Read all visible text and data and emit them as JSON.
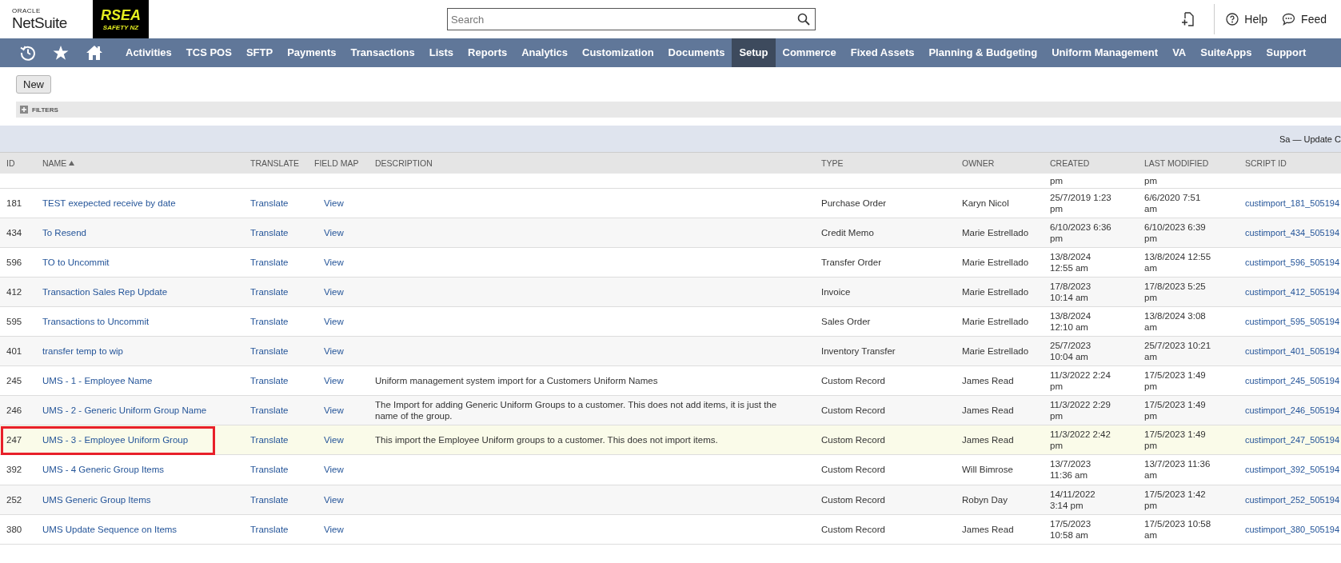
{
  "header": {
    "logo": {
      "top": "ORACLE",
      "bottom": "NetSuite"
    },
    "brand": {
      "name": "RSEA",
      "tagline": "SAFETY NZ"
    },
    "search": {
      "placeholder": "Search"
    },
    "links": [
      {
        "kind": "help",
        "label": "Help"
      },
      {
        "kind": "feedback",
        "label": "Feed"
      }
    ]
  },
  "nav": {
    "items": [
      {
        "label": "Activities",
        "selected": false
      },
      {
        "label": "TCS POS",
        "selected": false
      },
      {
        "label": "SFTP",
        "selected": false
      },
      {
        "label": "Payments",
        "selected": false
      },
      {
        "label": "Transactions",
        "selected": false
      },
      {
        "label": "Lists",
        "selected": false
      },
      {
        "label": "Reports",
        "selected": false
      },
      {
        "label": "Analytics",
        "selected": false
      },
      {
        "label": "Customization",
        "selected": false
      },
      {
        "label": "Documents",
        "selected": false
      },
      {
        "label": "Setup",
        "selected": true
      },
      {
        "label": "Commerce",
        "selected": false
      },
      {
        "label": "Fixed Assets",
        "selected": false
      },
      {
        "label": "Planning & Budgeting",
        "selected": false
      },
      {
        "label": "Uniform Management",
        "selected": false
      },
      {
        "label": "VA",
        "selected": false
      },
      {
        "label": "SuiteApps",
        "selected": false
      },
      {
        "label": "Support",
        "selected": false
      }
    ]
  },
  "toolbar": {
    "new_button": "New",
    "filters": {
      "label": "FILTERS",
      "expanded": false
    }
  },
  "band": {
    "text": "Sa — Update C"
  },
  "table": {
    "columns": [
      {
        "label": "ID",
        "sorted": false
      },
      {
        "label": "NAME",
        "sorted": true
      },
      {
        "label": "TRANSLATE",
        "sorted": false
      },
      {
        "label": "FIELD MAP",
        "sorted": false
      },
      {
        "label": "DESCRIPTION",
        "sorted": false
      },
      {
        "label": "TYPE",
        "sorted": false
      },
      {
        "label": "OWNER",
        "sorted": false
      },
      {
        "label": "CREATED",
        "sorted": false
      },
      {
        "label": "LAST MODIFIED",
        "sorted": false
      },
      {
        "label": "SCRIPT ID",
        "sorted": false
      }
    ],
    "rows": [
      {
        "kind": "partial",
        "created": "pm",
        "last_modified": "pm"
      },
      {
        "kind": "full",
        "id": "181",
        "name": "TEST exepected receive by date",
        "translate": "Translate",
        "field_map": "View",
        "description": "",
        "type": "Purchase Order",
        "owner": "Karyn Nicol",
        "created": "25/7/2019 1:23 pm",
        "last_modified": "6/6/2020 7:51 am",
        "script_id": "custimport_181_505194",
        "highlighted": false,
        "outlined": false
      },
      {
        "kind": "full",
        "id": "434",
        "name": "To Resend",
        "translate": "Translate",
        "field_map": "View",
        "description": "",
        "type": "Credit Memo",
        "owner": "Marie Estrellado",
        "created": "6/10/2023 6:36 pm",
        "last_modified": "6/10/2023 6:39 pm",
        "script_id": "custimport_434_505194",
        "highlighted": false,
        "outlined": false
      },
      {
        "kind": "full",
        "id": "596",
        "name": "TO to Uncommit",
        "translate": "Translate",
        "field_map": "View",
        "description": "",
        "type": "Transfer Order",
        "owner": "Marie Estrellado",
        "created": "13/8/2024 12:55 am",
        "last_modified": "13/8/2024 12:55 am",
        "script_id": "custimport_596_505194",
        "highlighted": false,
        "outlined": false
      },
      {
        "kind": "full",
        "id": "412",
        "name": "Transaction Sales Rep Update",
        "translate": "Translate",
        "field_map": "View",
        "description": "",
        "type": "Invoice",
        "owner": "Marie Estrellado",
        "created": "17/8/2023 10:14 am",
        "last_modified": "17/8/2023 5:25 pm",
        "script_id": "custimport_412_505194",
        "highlighted": false,
        "outlined": false
      },
      {
        "kind": "full",
        "id": "595",
        "name": "Transactions to Uncommit",
        "translate": "Translate",
        "field_map": "View",
        "description": "",
        "type": "Sales Order",
        "owner": "Marie Estrellado",
        "created": "13/8/2024 12:10 am",
        "last_modified": "13/8/2024 3:08 am",
        "script_id": "custimport_595_505194",
        "highlighted": false,
        "outlined": false
      },
      {
        "kind": "full",
        "id": "401",
        "name": "transfer temp to wip",
        "translate": "Translate",
        "field_map": "View",
        "description": "",
        "type": "Inventory Transfer",
        "owner": "Marie Estrellado",
        "created": "25/7/2023 10:04 am",
        "last_modified": "25/7/2023 10:21 am",
        "script_id": "custimport_401_505194",
        "highlighted": false,
        "outlined": false
      },
      {
        "kind": "full",
        "id": "245",
        "name": "UMS - 1 - Employee Name",
        "translate": "Translate",
        "field_map": "View",
        "description": "Uniform management system import for a Customers Uniform Names",
        "type": "Custom Record",
        "owner": "James Read",
        "created": "11/3/2022 2:24 pm",
        "last_modified": "17/5/2023 1:49 pm",
        "script_id": "custimport_245_505194",
        "highlighted": false,
        "outlined": false
      },
      {
        "kind": "full",
        "id": "246",
        "name": "UMS - 2 - Generic Uniform Group Name",
        "translate": "Translate",
        "field_map": "View",
        "description": "The Import for adding Generic Uniform Groups to a customer. This does not add items, it is just the name of the group.",
        "type": "Custom Record",
        "owner": "James Read",
        "created": "11/3/2022 2:29 pm",
        "last_modified": "17/5/2023 1:49 pm",
        "script_id": "custimport_246_505194",
        "highlighted": false,
        "outlined": false
      },
      {
        "kind": "full",
        "id": "247",
        "name": "UMS - 3 - Employee Uniform Group",
        "translate": "Translate",
        "field_map": "View",
        "description": "This import the Employee Uniform groups to a customer. This does not import items.",
        "type": "Custom Record",
        "owner": "James Read",
        "created": "11/3/2022 2:42 pm",
        "last_modified": "17/5/2023 1:49 pm",
        "script_id": "custimport_247_505194",
        "highlighted": true,
        "outlined": true
      },
      {
        "kind": "full",
        "id": "392",
        "name": "UMS - 4 Generic Group Items",
        "translate": "Translate",
        "field_map": "View",
        "description": "",
        "type": "Custom Record",
        "owner": "Will Bimrose",
        "created": "13/7/2023 11:36 am",
        "last_modified": "13/7/2023 11:36 am",
        "script_id": "custimport_392_505194",
        "highlighted": false,
        "outlined": false
      },
      {
        "kind": "full",
        "id": "252",
        "name": "UMS Generic Group Items",
        "translate": "Translate",
        "field_map": "View",
        "description": "",
        "type": "Custom Record",
        "owner": "Robyn Day",
        "created": "14/11/2022 3:14 pm",
        "last_modified": "17/5/2023 1:42 pm",
        "script_id": "custimport_252_505194",
        "highlighted": false,
        "outlined": false
      },
      {
        "kind": "full",
        "id": "380",
        "name": "UMS Update Sequence on Items",
        "translate": "Translate",
        "field_map": "View",
        "description": "",
        "type": "Custom Record",
        "owner": "James Read",
        "created": "17/5/2023 10:58 am",
        "last_modified": "17/5/2023 10:58 am",
        "script_id": "custimport_380_505194",
        "highlighted": false,
        "outlined": false
      }
    ]
  }
}
